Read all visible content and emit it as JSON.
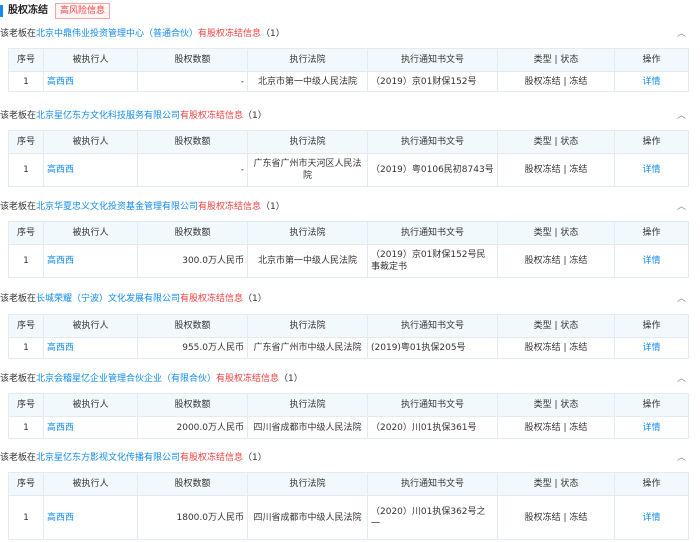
{
  "header": {
    "title": "股权冻结",
    "risk_badge": "高风险信息"
  },
  "labels": {
    "prefix": "该老板在",
    "suffix": "有股权冻结信息"
  },
  "columns": [
    "序号",
    "被执行人",
    "股权数额",
    "执行法院",
    "执行通知书文号",
    "类型 | 状态",
    "操作"
  ],
  "sections": [
    {
      "company": "北京中鼎伟业投资管理中心（普通合伙）",
      "count": "（1）",
      "row": {
        "no": "1",
        "person": "高西西",
        "amount": "-",
        "court": "北京市第一中级人民法院",
        "doc": "（2019）京01财保152号",
        "status": "股权冻结 | 冻结",
        "action": "详情"
      }
    },
    {
      "company": "北京星亿东方文化科技服务有限公司",
      "count": "（1）",
      "row": {
        "no": "1",
        "person": "高西西",
        "amount": "-",
        "court": "广东省广州市天河区人民法院",
        "doc": "（2019）粤0106民初8743号",
        "status": "股权冻结 | 冻结",
        "action": "详情"
      }
    },
    {
      "company": "北京华夏忠义文化投资基金管理有限公司",
      "count": "（1）",
      "row": {
        "no": "1",
        "person": "高西西",
        "amount": "300.0万人民币",
        "court": "北京市第一中级人民法院",
        "doc": "（2019）京01财保152号民事裁定书",
        "status": "股权冻结 | 冻结",
        "action": "详情"
      }
    },
    {
      "company": "长城荣耀（宁波）文化发展有限公司",
      "count": "（1）",
      "row": {
        "no": "1",
        "person": "高西西",
        "amount": "955.0万人民币",
        "court": "广东省广州市中级人民法院",
        "doc": "(2019)粤01执保205号",
        "status": "股权冻结 | 冻结",
        "action": "详情"
      }
    },
    {
      "company": "北京会稽星亿企业管理合伙企业（有限合伙）",
      "count": "（1）",
      "row": {
        "no": "1",
        "person": "高西西",
        "amount": "2000.0万人民币",
        "court": "四川省成都市中级人民法院",
        "doc": "（2020）川01执保361号",
        "status": "股权冻结 | 冻结",
        "action": "详情"
      }
    },
    {
      "company": "北京星亿东方影视文化传播有限公司",
      "count": "（1）",
      "row": {
        "no": "1",
        "person": "高西西",
        "amount": "1800.0万人民币",
        "court": "四川省成都市中级人民法院",
        "doc": "（2020）川01执保362号之一",
        "status": "股权冻结 | 冻结",
        "action": "详情"
      }
    }
  ]
}
